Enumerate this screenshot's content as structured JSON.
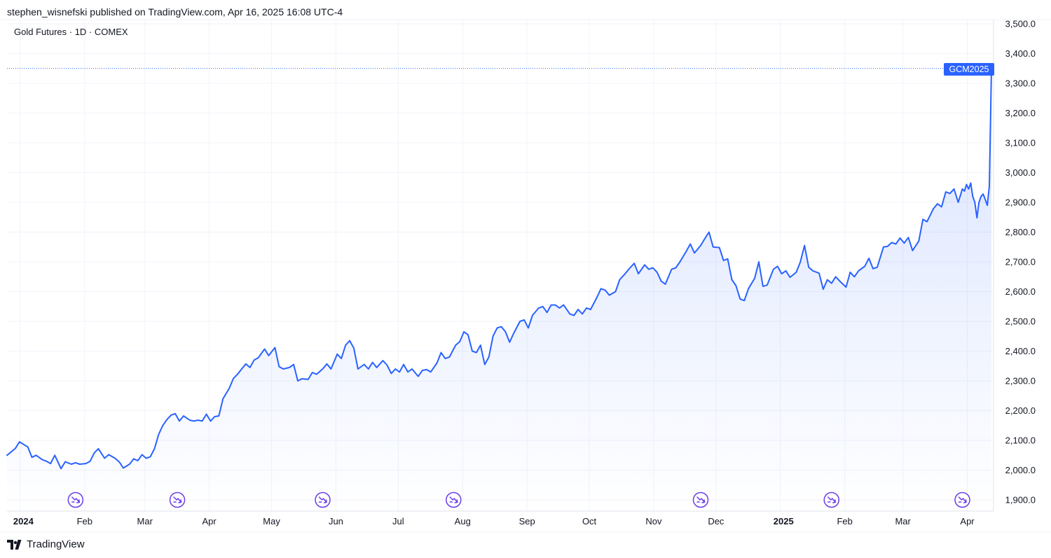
{
  "header": {
    "published": "stephen_wisnefski published on TradingView.com, Apr 16, 2025 16:08 UTC-4"
  },
  "symbol": {
    "title": "Gold Futures · 1D · COMEX",
    "tag": "GCM2025"
  },
  "footer": {
    "brand": "TradingView",
    "logo_icon": "tradingview-logo-icon"
  },
  "colors": {
    "line": "#2962ff",
    "grid": "#f0f3fa",
    "text": "#131722",
    "event": "#6a3ce8"
  },
  "chart_data": {
    "type": "area",
    "ylim": [
      1900,
      3500
    ],
    "yticks": [
      "1,900.0",
      "2,000.0",
      "2,100.0",
      "2,200.0",
      "2,300.0",
      "2,400.0",
      "2,500.0",
      "2,600.0",
      "2,700.0",
      "2,800.0",
      "2,900.0",
      "3,000.0",
      "3,100.0",
      "3,200.0",
      "3,300.0",
      "3,400.0",
      "3,500.0"
    ],
    "ytick_values": [
      1900,
      2000,
      2100,
      2200,
      2300,
      2400,
      2500,
      2600,
      2700,
      2800,
      2900,
      3000,
      3100,
      3200,
      3300,
      3400,
      3500
    ],
    "xticks": [
      {
        "label": "2024",
        "date": "2024-01-01",
        "bold": true
      },
      {
        "label": "Feb",
        "date": "2024-02-01"
      },
      {
        "label": "Mar",
        "date": "2024-03-01"
      },
      {
        "label": "Apr",
        "date": "2024-04-01"
      },
      {
        "label": "May",
        "date": "2024-05-01"
      },
      {
        "label": "Jun",
        "date": "2024-06-01"
      },
      {
        "label": "Jul",
        "date": "2024-07-01"
      },
      {
        "label": "Aug",
        "date": "2024-08-01"
      },
      {
        "label": "Sep",
        "date": "2024-09-01"
      },
      {
        "label": "Oct",
        "date": "2024-10-01"
      },
      {
        "label": "Nov",
        "date": "2024-11-01"
      },
      {
        "label": "Dec",
        "date": "2024-12-01"
      },
      {
        "label": "2025",
        "date": "2025-01-01",
        "bold": true
      },
      {
        "label": "Feb",
        "date": "2025-02-01"
      },
      {
        "label": "Mar",
        "date": "2025-03-01"
      },
      {
        "label": "Apr",
        "date": "2025-04-01"
      }
    ],
    "last_price": 3350,
    "events": [
      "2024-01-31",
      "2024-03-20",
      "2024-05-29",
      "2024-07-31",
      "2024-11-27",
      "2025-01-29",
      "2025-04-02"
    ],
    "series": [
      {
        "points": [
          [
            "2023-12-29",
            2050
          ],
          [
            "2024-01-02",
            2073
          ],
          [
            "2024-01-04",
            2095
          ],
          [
            "2024-01-08",
            2078
          ],
          [
            "2024-01-10",
            2043
          ],
          [
            "2024-01-12",
            2050
          ],
          [
            "2024-01-15",
            2035
          ],
          [
            "2024-01-17",
            2030
          ],
          [
            "2024-01-19",
            2022
          ],
          [
            "2024-01-21",
            2050
          ],
          [
            "2024-01-24",
            2005
          ],
          [
            "2024-01-26",
            2028
          ],
          [
            "2024-01-29",
            2020
          ],
          [
            "2024-01-31",
            2025
          ],
          [
            "2024-02-02",
            2020
          ],
          [
            "2024-02-05",
            2022
          ],
          [
            "2024-02-07",
            2030
          ],
          [
            "2024-02-09",
            2058
          ],
          [
            "2024-02-11",
            2072
          ],
          [
            "2024-02-14",
            2040
          ],
          [
            "2024-02-16",
            2052
          ],
          [
            "2024-02-19",
            2040
          ],
          [
            "2024-02-21",
            2028
          ],
          [
            "2024-02-23",
            2007
          ],
          [
            "2024-02-26",
            2020
          ],
          [
            "2024-02-28",
            2038
          ],
          [
            "2024-03-01",
            2032
          ],
          [
            "2024-03-03",
            2052
          ],
          [
            "2024-03-05",
            2040
          ],
          [
            "2024-03-07",
            2045
          ],
          [
            "2024-03-09",
            2072
          ],
          [
            "2024-03-11",
            2120
          ],
          [
            "2024-03-13",
            2150
          ],
          [
            "2024-03-15",
            2170
          ],
          [
            "2024-03-17",
            2185
          ],
          [
            "2024-03-19",
            2190
          ],
          [
            "2024-03-21",
            2165
          ],
          [
            "2024-03-23",
            2182
          ],
          [
            "2024-03-26",
            2168
          ],
          [
            "2024-03-28",
            2165
          ],
          [
            "2024-03-30",
            2168
          ],
          [
            "2024-04-01",
            2165
          ],
          [
            "2024-04-03",
            2188
          ],
          [
            "2024-04-05",
            2165
          ],
          [
            "2024-04-07",
            2180
          ],
          [
            "2024-04-09",
            2182
          ],
          [
            "2024-04-11",
            2240
          ],
          [
            "2024-04-14",
            2275
          ],
          [
            "2024-04-16",
            2308
          ],
          [
            "2024-04-18",
            2322
          ],
          [
            "2024-04-20",
            2340
          ],
          [
            "2024-04-22",
            2357
          ],
          [
            "2024-04-24",
            2345
          ],
          [
            "2024-04-26",
            2370
          ],
          [
            "2024-04-28",
            2378
          ],
          [
            "2024-05-01",
            2407
          ],
          [
            "2024-05-03",
            2385
          ],
          [
            "2024-05-06",
            2412
          ],
          [
            "2024-05-08",
            2348
          ],
          [
            "2024-05-10",
            2340
          ],
          [
            "2024-05-13",
            2345
          ],
          [
            "2024-05-15",
            2355
          ],
          [
            "2024-05-17",
            2300
          ],
          [
            "2024-05-19",
            2307
          ],
          [
            "2024-05-22",
            2305
          ],
          [
            "2024-05-24",
            2328
          ],
          [
            "2024-05-26",
            2322
          ],
          [
            "2024-05-29",
            2340
          ],
          [
            "2024-05-31",
            2357
          ],
          [
            "2024-06-02",
            2340
          ],
          [
            "2024-06-05",
            2390
          ],
          [
            "2024-06-07",
            2375
          ],
          [
            "2024-06-09",
            2420
          ],
          [
            "2024-06-11",
            2435
          ],
          [
            "2024-06-13",
            2410
          ],
          [
            "2024-06-15",
            2340
          ],
          [
            "2024-06-18",
            2355
          ],
          [
            "2024-06-20",
            2340
          ],
          [
            "2024-06-22",
            2362
          ],
          [
            "2024-06-24",
            2345
          ],
          [
            "2024-06-27",
            2368
          ],
          [
            "2024-06-29",
            2353
          ],
          [
            "2024-07-01",
            2325
          ],
          [
            "2024-07-03",
            2340
          ],
          [
            "2024-07-05",
            2330
          ],
          [
            "2024-07-07",
            2355
          ],
          [
            "2024-07-09",
            2330
          ],
          [
            "2024-07-11",
            2340
          ],
          [
            "2024-07-14",
            2315
          ],
          [
            "2024-07-16",
            2335
          ],
          [
            "2024-07-18",
            2338
          ],
          [
            "2024-07-20",
            2330
          ],
          [
            "2024-07-23",
            2360
          ],
          [
            "2024-07-25",
            2395
          ],
          [
            "2024-07-27",
            2375
          ],
          [
            "2024-07-29",
            2380
          ],
          [
            "2024-08-01",
            2420
          ],
          [
            "2024-08-03",
            2432
          ],
          [
            "2024-08-05",
            2465
          ],
          [
            "2024-08-07",
            2455
          ],
          [
            "2024-08-09",
            2400
          ],
          [
            "2024-08-11",
            2395
          ],
          [
            "2024-08-13",
            2420
          ],
          [
            "2024-08-15",
            2355
          ],
          [
            "2024-08-17",
            2380
          ],
          [
            "2024-08-19",
            2450
          ],
          [
            "2024-08-21",
            2478
          ],
          [
            "2024-08-23",
            2482
          ],
          [
            "2024-08-25",
            2465
          ],
          [
            "2024-08-27",
            2430
          ],
          [
            "2024-08-29",
            2460
          ],
          [
            "2024-09-01",
            2500
          ],
          [
            "2024-09-03",
            2505
          ],
          [
            "2024-09-05",
            2478
          ],
          [
            "2024-09-07",
            2520
          ],
          [
            "2024-09-10",
            2545
          ],
          [
            "2024-09-12",
            2550
          ],
          [
            "2024-09-14",
            2530
          ],
          [
            "2024-09-16",
            2555
          ],
          [
            "2024-09-18",
            2555
          ],
          [
            "2024-09-20",
            2545
          ],
          [
            "2024-09-22",
            2555
          ],
          [
            "2024-09-25",
            2525
          ],
          [
            "2024-09-27",
            2520
          ],
          [
            "2024-09-29",
            2540
          ],
          [
            "2024-10-01",
            2525
          ],
          [
            "2024-10-03",
            2545
          ],
          [
            "2024-10-05",
            2540
          ],
          [
            "2024-10-08",
            2580
          ],
          [
            "2024-10-10",
            2610
          ],
          [
            "2024-10-12",
            2605
          ],
          [
            "2024-10-14",
            2588
          ],
          [
            "2024-10-17",
            2600
          ],
          [
            "2024-10-19",
            2640
          ],
          [
            "2024-10-21",
            2655
          ],
          [
            "2024-10-24",
            2680
          ],
          [
            "2024-10-26",
            2695
          ],
          [
            "2024-10-28",
            2660
          ],
          [
            "2024-10-31",
            2690
          ],
          [
            "2024-11-02",
            2675
          ],
          [
            "2024-11-04",
            2680
          ],
          [
            "2024-11-06",
            2665
          ],
          [
            "2024-11-08",
            2635
          ],
          [
            "2024-11-10",
            2625
          ],
          [
            "2024-11-13",
            2675
          ],
          [
            "2024-11-15",
            2680
          ],
          [
            "2024-11-17",
            2700
          ],
          [
            "2024-11-20",
            2735
          ],
          [
            "2024-11-22",
            2760
          ],
          [
            "2024-11-24",
            2730
          ],
          [
            "2024-11-27",
            2755
          ],
          [
            "2024-11-29",
            2778
          ],
          [
            "2024-12-01",
            2800
          ],
          [
            "2024-12-03",
            2750
          ],
          [
            "2024-12-06",
            2748
          ],
          [
            "2024-12-08",
            2705
          ],
          [
            "2024-12-10",
            2710
          ],
          [
            "2024-12-12",
            2640
          ],
          [
            "2024-12-14",
            2620
          ],
          [
            "2024-12-16",
            2575
          ],
          [
            "2024-12-18",
            2570
          ],
          [
            "2024-12-20",
            2610
          ],
          [
            "2024-12-23",
            2645
          ],
          [
            "2024-12-25",
            2700
          ],
          [
            "2024-12-27",
            2618
          ],
          [
            "2024-12-29",
            2622
          ],
          [
            "2025-01-01",
            2675
          ],
          [
            "2025-01-03",
            2685
          ],
          [
            "2025-01-05",
            2660
          ],
          [
            "2025-01-07",
            2670
          ],
          [
            "2025-01-09",
            2648
          ],
          [
            "2025-01-12",
            2665
          ],
          [
            "2025-01-14",
            2700
          ],
          [
            "2025-01-16",
            2755
          ],
          [
            "2025-01-18",
            2682
          ],
          [
            "2025-01-20",
            2670
          ],
          [
            "2025-01-23",
            2662
          ],
          [
            "2025-01-25",
            2608
          ],
          [
            "2025-01-27",
            2640
          ],
          [
            "2025-01-29",
            2628
          ],
          [
            "2025-01-31",
            2650
          ],
          [
            "2025-02-02",
            2635
          ],
          [
            "2025-02-05",
            2615
          ],
          [
            "2025-02-07",
            2665
          ],
          [
            "2025-02-09",
            2650
          ],
          [
            "2025-02-11",
            2670
          ],
          [
            "2025-02-14",
            2685
          ],
          [
            "2025-02-16",
            2712
          ],
          [
            "2025-02-18",
            2677
          ],
          [
            "2025-02-20",
            2682
          ],
          [
            "2025-02-23",
            2750
          ],
          [
            "2025-02-25",
            2752
          ],
          [
            "2025-02-27",
            2765
          ],
          [
            "2025-03-01",
            2760
          ],
          [
            "2025-03-03",
            2780
          ],
          [
            "2025-03-05",
            2763
          ],
          [
            "2025-03-07",
            2782
          ],
          [
            "2025-03-09",
            2738
          ],
          [
            "2025-03-12",
            2770
          ],
          [
            "2025-03-14",
            2843
          ],
          [
            "2025-03-16",
            2835
          ],
          [
            "2025-03-19",
            2878
          ],
          [
            "2025-03-21",
            2895
          ],
          [
            "2025-03-23",
            2885
          ],
          [
            "2025-03-25",
            2935
          ],
          [
            "2025-03-27",
            2930
          ],
          [
            "2025-03-29",
            2945
          ],
          [
            "2025-03-31",
            2900
          ],
          [
            "2025-04-02",
            2945
          ],
          [
            "2025-04-03",
            2938
          ],
          [
            "2025-04-04",
            2960
          ],
          [
            "2025-04-05",
            2945
          ],
          [
            "2025-04-06",
            2965
          ],
          [
            "2025-04-07",
            2920
          ],
          [
            "2025-04-08",
            2900
          ],
          [
            "2025-04-09",
            2848
          ],
          [
            "2025-04-10",
            2900
          ],
          [
            "2025-04-11",
            2920
          ],
          [
            "2025-04-12",
            2928
          ],
          [
            "2025-04-13",
            2910
          ],
          [
            "2025-04-14",
            2890
          ],
          [
            "2025-04-15",
            2955
          ],
          [
            "2025-04-16",
            3350
          ]
        ]
      }
    ]
  }
}
